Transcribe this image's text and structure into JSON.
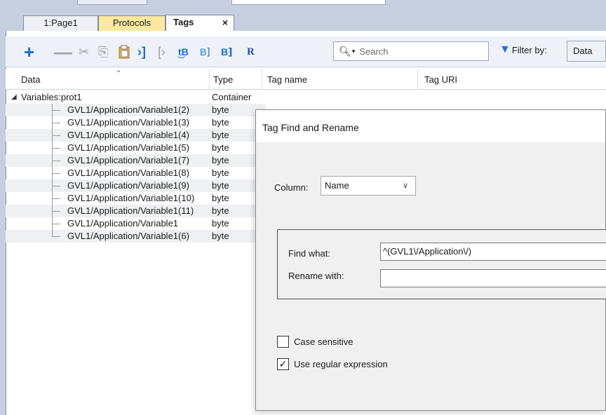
{
  "tabs": {
    "page1": "1:Page1",
    "protocols": "Protocols",
    "tags": "Tags",
    "tags_close": "×"
  },
  "toolbar": {
    "icons": {
      "add": "+",
      "remove": "—",
      "cut": "✂",
      "copy": "⎘",
      "paste": "📋",
      "pin": "›]",
      "unpin": "[›",
      "tb1": "t͜B",
      "tb2": "B⁆",
      "tb3": "B⁆",
      "r": "R"
    },
    "search_placeholder": "Search",
    "filter_label": "Filter by:",
    "filter_value": "Data"
  },
  "grid": {
    "headers": {
      "data": "Data",
      "type": "Type",
      "tag_name": "Tag name",
      "tag_uri": "Tag URI"
    },
    "parent": {
      "name": "Variables:prot1",
      "type": "Container"
    },
    "rows": [
      {
        "name": "GVL1/Application/Variable1(2)",
        "type": "byte"
      },
      {
        "name": "GVL1/Application/Variable1(3)",
        "type": "byte"
      },
      {
        "name": "GVL1/Application/Variable1(4)",
        "type": "byte"
      },
      {
        "name": "GVL1/Application/Variable1(5)",
        "type": "byte"
      },
      {
        "name": "GVL1/Application/Variable1(7)",
        "type": "byte"
      },
      {
        "name": "GVL1/Application/Variable1(8)",
        "type": "byte"
      },
      {
        "name": "GVL1/Application/Variable1(9)",
        "type": "byte"
      },
      {
        "name": "GVL1/Application/Variable1(10)",
        "type": "byte"
      },
      {
        "name": "GVL1/Application/Variable1(11)",
        "type": "byte"
      },
      {
        "name": "GVL1/Application/Variable1",
        "type": "byte"
      },
      {
        "name": "GVL1/Application/Variable1(6)",
        "type": "byte"
      }
    ]
  },
  "dialog": {
    "title": "Tag Find and Rename",
    "column_label": "Column:",
    "column_value": "Name",
    "find_what_label": "Find what:",
    "find_what_value": "^(GVL1\\/Application\\/)",
    "rename_with_label": "Rename with:",
    "rename_with_value": "",
    "case_sensitive_label": "Case sensitive",
    "case_sensitive_checked": false,
    "use_regex_label": "Use regular expression",
    "use_regex_checked": true
  }
}
